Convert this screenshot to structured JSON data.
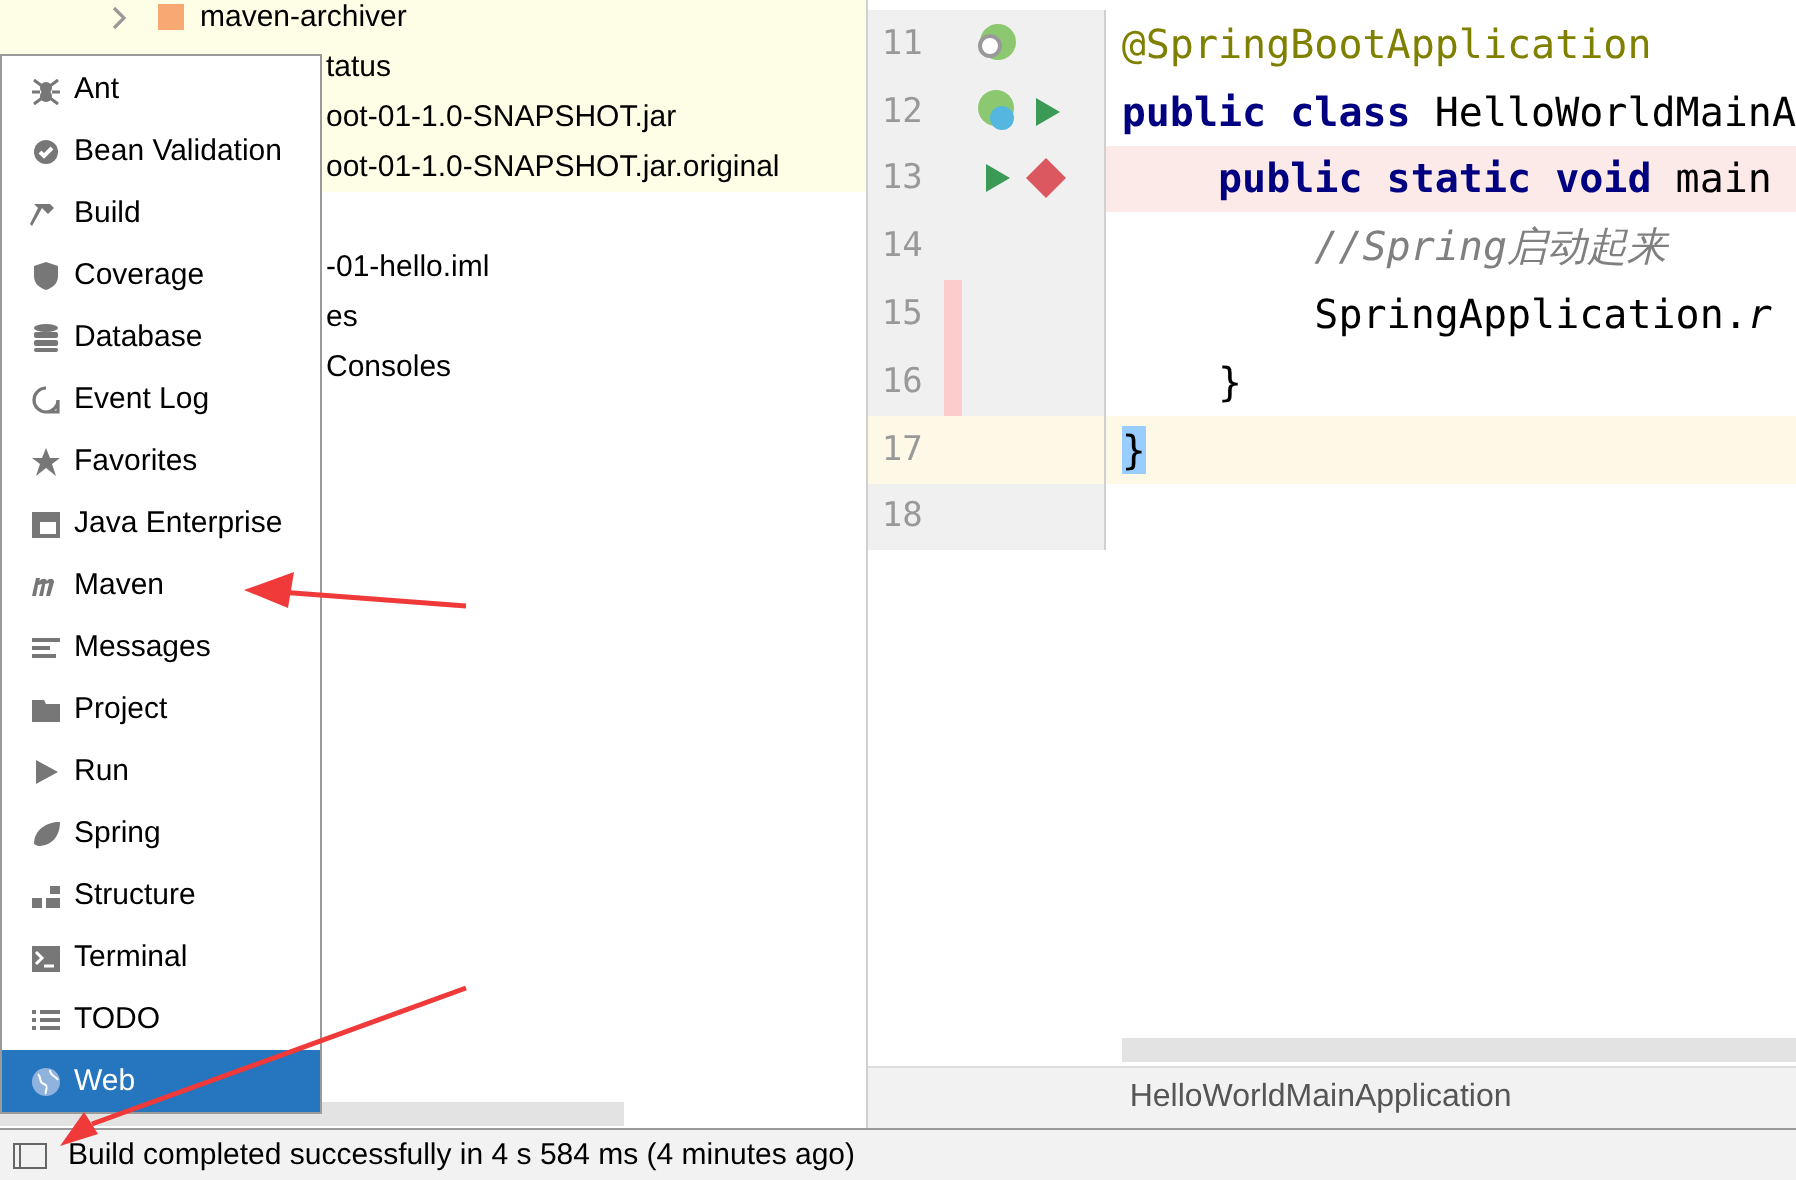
{
  "project_tree": {
    "rows": [
      {
        "label": "maven-archiver",
        "highlighted": true
      },
      {
        "label": "tatus",
        "highlighted": true
      },
      {
        "label": "oot-01-1.0-SNAPSHOT.jar",
        "highlighted": true
      },
      {
        "label": "oot-01-1.0-SNAPSHOT.jar.original",
        "highlighted": true
      },
      {
        "label": "-01-hello.iml",
        "highlighted": false
      },
      {
        "label": "es",
        "highlighted": false
      },
      {
        "label": "Consoles",
        "highlighted": false
      }
    ]
  },
  "tool_window_menu": {
    "items": [
      {
        "label": "Ant",
        "selected": false
      },
      {
        "label": "Bean Validation",
        "selected": false
      },
      {
        "label": "Build",
        "selected": false
      },
      {
        "label": "Coverage",
        "selected": false
      },
      {
        "label": "Database",
        "selected": false
      },
      {
        "label": "Event Log",
        "selected": false
      },
      {
        "label": "Favorites",
        "selected": false
      },
      {
        "label": "Java Enterprise",
        "selected": false
      },
      {
        "label": "Maven",
        "selected": false
      },
      {
        "label": "Messages",
        "selected": false
      },
      {
        "label": "Project",
        "selected": false
      },
      {
        "label": "Run",
        "selected": false
      },
      {
        "label": "Spring",
        "selected": false
      },
      {
        "label": "Structure",
        "selected": false
      },
      {
        "label": "Terminal",
        "selected": false
      },
      {
        "label": "TODO",
        "selected": false
      },
      {
        "label": "Web",
        "selected": true
      }
    ]
  },
  "editor": {
    "lines": [
      {
        "number": "11",
        "breakpoint": false,
        "changed": false,
        "current": false,
        "tokens": [
          {
            "kind": "annotation",
            "text": "@SpringBootApplication"
          }
        ]
      },
      {
        "number": "12",
        "breakpoint": false,
        "changed": false,
        "current": false,
        "tokens": [
          {
            "kind": "keyword",
            "text": "public class "
          },
          {
            "kind": "plain",
            "text": "HelloWorldMainA"
          }
        ]
      },
      {
        "number": "13",
        "breakpoint": true,
        "changed": false,
        "current": false,
        "tokens": [
          {
            "kind": "keyword",
            "text": "    public static void "
          },
          {
            "kind": "plain",
            "text": "main"
          }
        ]
      },
      {
        "number": "14",
        "breakpoint": false,
        "changed": false,
        "current": false,
        "tokens": [
          {
            "kind": "comment",
            "text": "        //Spring启动起来"
          }
        ]
      },
      {
        "number": "15",
        "breakpoint": false,
        "changed": true,
        "current": false,
        "tokens": [
          {
            "kind": "plain",
            "text": "        SpringApplication."
          },
          {
            "kind": "static",
            "text": "r"
          }
        ]
      },
      {
        "number": "16",
        "breakpoint": false,
        "changed": true,
        "current": false,
        "tokens": [
          {
            "kind": "plain",
            "text": "    }"
          }
        ]
      },
      {
        "number": "17",
        "breakpoint": false,
        "changed": false,
        "current": true,
        "tokens": [
          {
            "kind": "matched",
            "text": "}"
          }
        ]
      },
      {
        "number": "18",
        "breakpoint": false,
        "changed": false,
        "current": false
      }
    ],
    "breadcrumb": "HelloWorldMainApplication"
  },
  "status_bar": {
    "message": "Build completed successfully in 4 s 584 ms (4 minutes ago)"
  }
}
